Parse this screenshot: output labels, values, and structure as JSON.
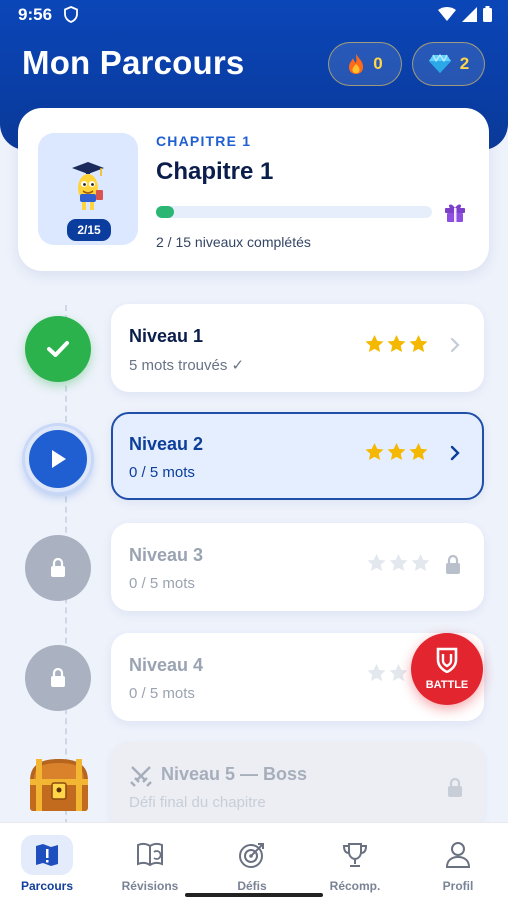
{
  "status_bar": {
    "time": "9:56"
  },
  "header": {
    "title": "Mon Parcours",
    "streak_count": "0",
    "gems_count": "2"
  },
  "chapter": {
    "kicker": "CHAPITRE 1",
    "title": "Chapitre 1",
    "badge": "2/15",
    "progress_label": "2 / 15 niveaux complétés",
    "progress_fraction": 0.067
  },
  "levels": [
    {
      "title": "Niveau 1",
      "subtitle": "5 mots trouvés ✓",
      "state": "done",
      "stars": 3
    },
    {
      "title": "Niveau 2",
      "subtitle": "0 / 5 mots",
      "state": "active",
      "stars": 3
    },
    {
      "title": "Niveau 3",
      "subtitle": "0 / 5 mots",
      "state": "locked",
      "stars": 0
    },
    {
      "title": "Niveau 4",
      "subtitle": "0 / 5 mots",
      "state": "locked",
      "stars": 0
    },
    {
      "title": "Niveau 5 — Boss",
      "subtitle": "Défi final du chapitre",
      "state": "boss",
      "stars": 0
    }
  ],
  "battle_label": "BATTLE",
  "nav": [
    {
      "label": "Parcours",
      "icon": "map-icon",
      "active": true
    },
    {
      "label": "Révisions",
      "icon": "review-book-icon",
      "active": false
    },
    {
      "label": "Défis",
      "icon": "target-icon",
      "active": false
    },
    {
      "label": "Récomp.",
      "icon": "trophy-icon",
      "active": false
    },
    {
      "label": "Profil",
      "icon": "user-icon",
      "active": false
    }
  ],
  "colors": {
    "header_blue": "#0b46b8",
    "accent_blue": "#1f5fd1",
    "done_green": "#2bb24c",
    "star_gold": "#f5b800",
    "battle_red": "#e3252f"
  }
}
